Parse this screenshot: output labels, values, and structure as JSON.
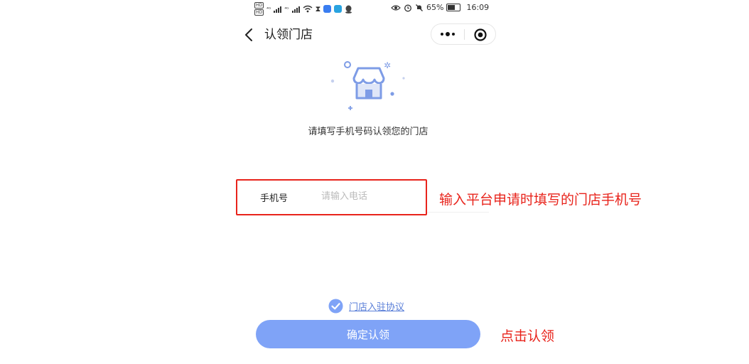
{
  "status_bar": {
    "hd_badge": "HD",
    "signal_label_1": "⁴ᴳ",
    "signal_label_2": "⁴ᴳ",
    "battery": "65%",
    "time": "16:09"
  },
  "nav": {
    "title": "认领门店"
  },
  "header": {
    "subtitle": "请填写手机号码认领您的门店"
  },
  "form": {
    "phone_label": "手机号",
    "phone_value": "",
    "phone_placeholder": "请输入电话"
  },
  "annotations": {
    "phone_hint": "输入平台申请时填写的门店手机号",
    "confirm_hint": "点击认领"
  },
  "agreement": {
    "link_label": "门店入驻协议",
    "checked": true
  },
  "actions": {
    "confirm_label": "确定认领"
  },
  "colors": {
    "accent": "#7fa3f7",
    "link": "#5a7fd8",
    "annotation": "#e8231b",
    "icon_blue": "#7e9ce6"
  },
  "icons": {
    "back": "chevron-left-icon",
    "more": "more-dots-icon",
    "close": "target-circle-icon",
    "store": "store-icon",
    "check": "check-circle-icon"
  }
}
